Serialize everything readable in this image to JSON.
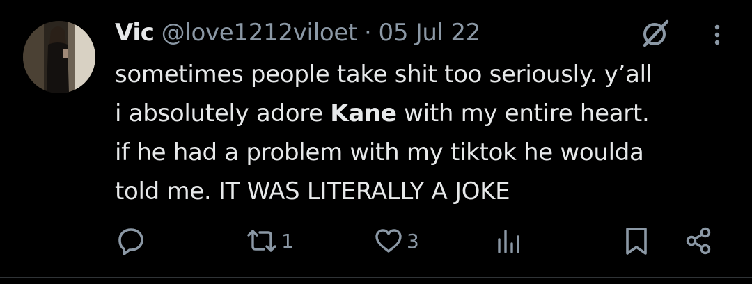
{
  "tweet": {
    "author": {
      "display_name": "Vic",
      "handle": "@love1212viloet",
      "separator": "·",
      "date": "05 Jul 22"
    },
    "text": {
      "line1": "sometimes people take shit too seriously. y’all",
      "line2_before": "i absolutely adore ",
      "line2_mention": "Kane",
      "line2_after": " with my entire heart.",
      "line3": "if he had a problem with my tiktok he woulda",
      "line4": "told me. IT WAS LITERALLY A JOKE"
    },
    "actions": {
      "reply_count": "",
      "retweet_count": "1",
      "like_count": "3",
      "views_count": ""
    },
    "icons": {
      "grok": "grok-slash-circle-icon",
      "more": "more-vertical-icon",
      "reply": "reply-icon",
      "retweet": "retweet-icon",
      "like": "heart-icon",
      "views": "views-bar-chart-icon",
      "bookmark": "bookmark-icon",
      "share": "share-icon"
    },
    "colors": {
      "background": "#000000",
      "text": "#e7e9ea",
      "secondary_text": "#8b98a5"
    }
  }
}
